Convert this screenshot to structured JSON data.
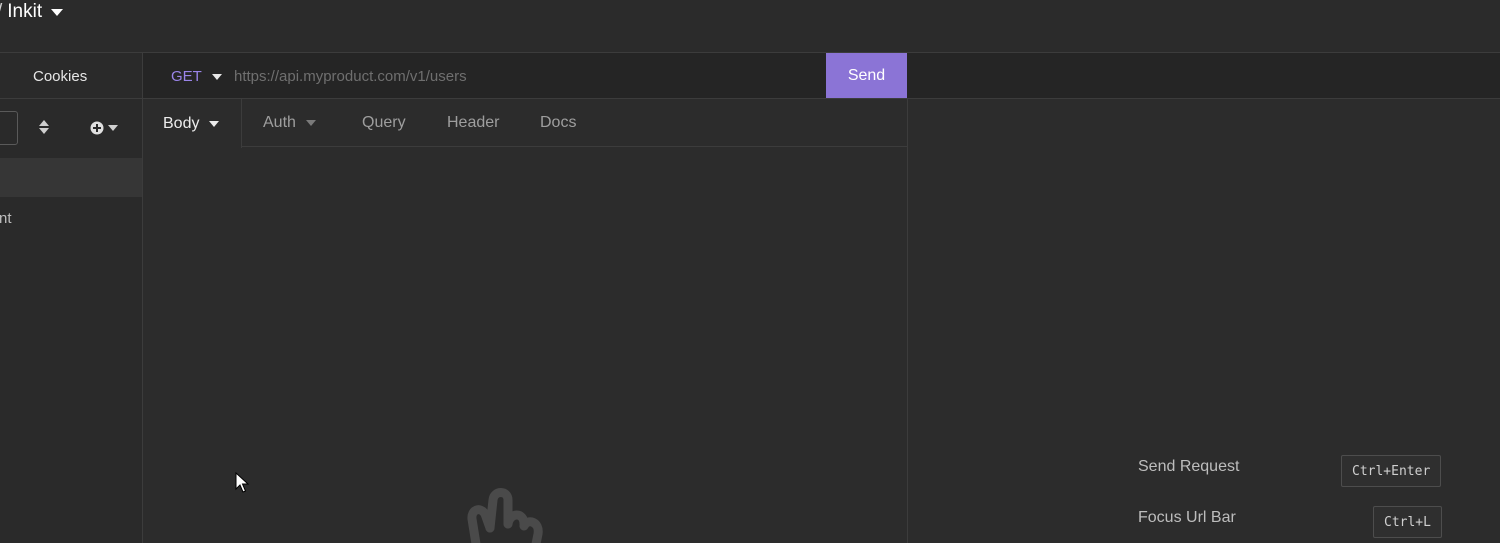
{
  "header": {
    "workspace_prefix": "/",
    "workspace_name": "Inkit"
  },
  "sidebar": {
    "cookies_label": "Cookies",
    "items": [
      {
        "label": "nt"
      }
    ]
  },
  "request": {
    "method": "GET",
    "url_value": "",
    "url_placeholder": "https://api.myproduct.com/v1/users",
    "send_label": "Send",
    "tabs": [
      {
        "label": "Body",
        "active": true,
        "has_dropdown": true
      },
      {
        "label": "Auth",
        "active": false,
        "has_dropdown": true
      },
      {
        "label": "Query",
        "active": false
      },
      {
        "label": "Header",
        "active": false
      },
      {
        "label": "Docs",
        "active": false
      }
    ]
  },
  "response": {
    "shortcuts": [
      {
        "label": "Send Request",
        "keys": "Ctrl+Enter"
      },
      {
        "label": "Focus Url Bar",
        "keys": "Ctrl+L"
      }
    ]
  },
  "colors": {
    "accent": "#8b74d6",
    "method_get": "#9a84e8",
    "background": "#2c2c2c"
  },
  "icons": [
    "chevron-down-icon",
    "sort-icon",
    "add-circle-icon",
    "hand-icon",
    "cursor-icon"
  ]
}
